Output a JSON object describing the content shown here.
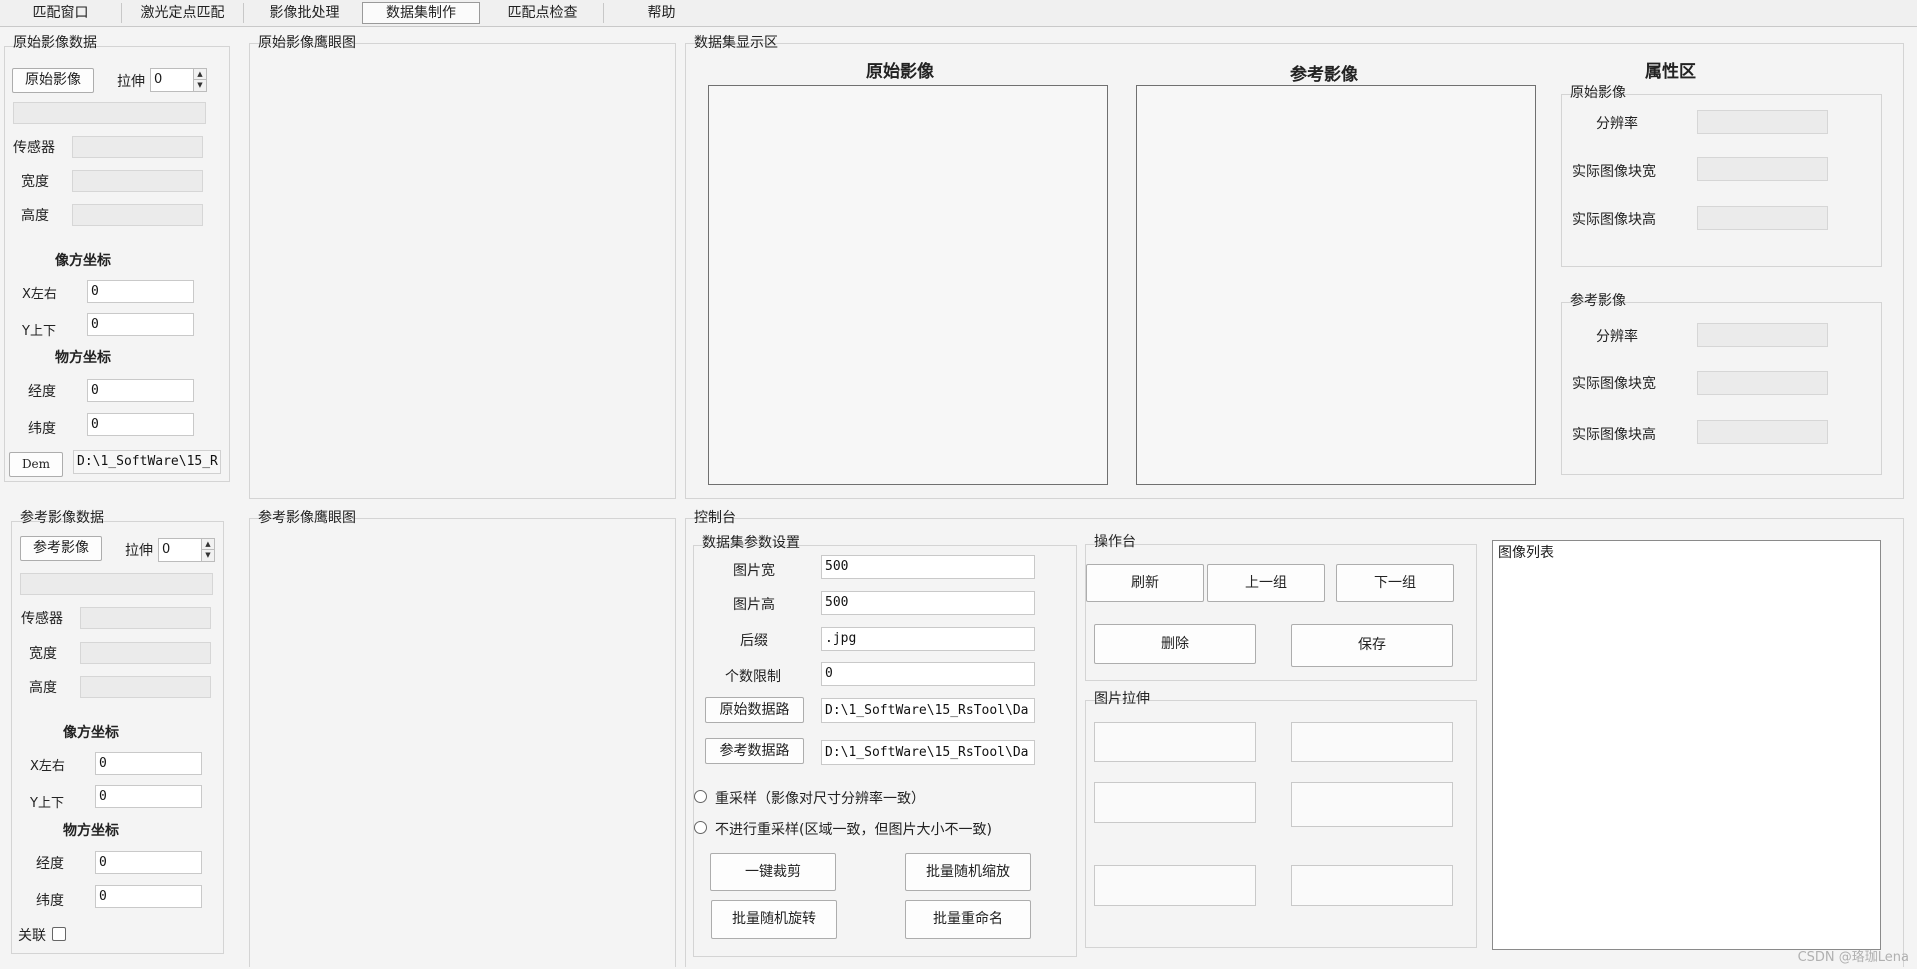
{
  "tabs": [
    "匹配窗口",
    "激光定点匹配",
    "影像批处理",
    "数据集制作",
    "匹配点检查",
    "帮助"
  ],
  "orig_data": {
    "title": "原始影像数据",
    "image_btn": "原始影像",
    "stretch_label": "拉伸",
    "stretch_value": "0",
    "sensor": "传感器",
    "width": "宽度",
    "height": "高度",
    "pixel_coord": "像方坐标",
    "x_label": "X左右",
    "x_value": "0",
    "y_label": "Y上下",
    "y_value": "0",
    "object_coord": "物方坐标",
    "lon_label": "经度",
    "lon_value": "0",
    "lat_label": "纬度",
    "lat_value": "0",
    "dem_btn": "Dem",
    "dem_path": "D:\\1_SoftWare\\15_R"
  },
  "orig_overview": {
    "title": "原始影像鹰眼图"
  },
  "ref_data": {
    "title": "参考影像数据",
    "image_btn": "参考影像",
    "stretch_label": "拉伸",
    "stretch_value": "0",
    "sensor": "传感器",
    "width": "宽度",
    "height": "高度",
    "pixel_coord": "像方坐标",
    "x_label": "X左右",
    "x_value": "0",
    "y_label": "Y上下",
    "y_value": "0",
    "object_coord": "物方坐标",
    "lon_label": "经度",
    "lon_value": "0",
    "lat_label": "纬度",
    "lat_value": "0",
    "link_label": "关联"
  },
  "ref_overview": {
    "title": "参考影像鹰眼图"
  },
  "display": {
    "title": "数据集显示区",
    "orig_header": "原始影像",
    "ref_header": "参考影像",
    "attr_header": "属性区",
    "orig_group": "原始影像",
    "ref_group": "参考影像",
    "resolution": "分辨率",
    "block_w": "实际图像块宽",
    "block_h": "实际图像块高"
  },
  "console": {
    "title": "控制台",
    "params": {
      "title": "数据集参数设置",
      "img_w_label": "图片宽",
      "img_w_value": "500",
      "img_h_label": "图片高",
      "img_h_value": "500",
      "suffix_label": "后缀",
      "suffix_value": ".jpg",
      "limit_label": "个数限制",
      "limit_value": "0",
      "orig_path_btn": "原始数据路",
      "orig_path_value": "D:\\1_SoftWare\\15_RsTool\\Da",
      "ref_path_btn": "参考数据路",
      "ref_path_value": "D:\\1_SoftWare\\15_RsTool\\Da",
      "resample_opt": "重采样（影像对尺寸分辨率一致）",
      "noresample_opt": "不进行重采样(区域一致，但图片大小不一致)",
      "crop_btn": "一键裁剪",
      "scale_btn": "批量随机缩放",
      "rotate_btn": "批量随机旋转",
      "rename_btn": "批量重命名"
    },
    "ops": {
      "title": "操作台",
      "refresh": "刷新",
      "prev": "上一组",
      "next": "下一组",
      "delete": "删除",
      "save": "保存"
    },
    "stretch": {
      "title": "图片拉伸"
    },
    "list": {
      "title": "图像列表"
    }
  },
  "watermark": "CSDN @珞珈Lena"
}
